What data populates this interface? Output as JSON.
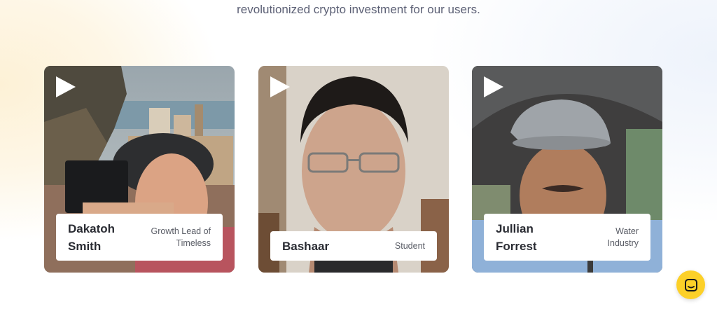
{
  "section": {
    "subtitle": "revolutionized crypto investment for our users."
  },
  "testimonials": [
    {
      "name": "Dakatoh Smith",
      "role": "Growth Lead of Timeless"
    },
    {
      "name": "Bashaar",
      "role": "Student"
    },
    {
      "name": "Jullian Forrest",
      "role": "Water Industry"
    }
  ],
  "icons": {
    "play": "play-icon",
    "chat": "chat-icon"
  },
  "colors": {
    "accent": "#fcd028",
    "text_primary": "#2a2c33",
    "text_muted": "#5c6075"
  }
}
